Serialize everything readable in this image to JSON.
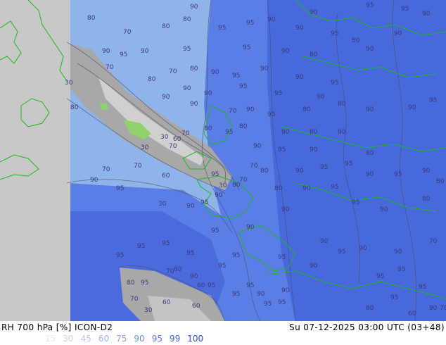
{
  "header": {
    "title_left": "RH 700 hPa [%] ICON-D2",
    "title_right": "Su 07-12-2025 03:00 UTC (03+48)"
  },
  "legend": {
    "items": [
      {
        "label": "15",
        "color": "#e6e6f5"
      },
      {
        "label": "30",
        "color": "#d0d0ee"
      },
      {
        "label": "45",
        "color": "#b8c4ea"
      },
      {
        "label": "60",
        "color": "#9fb6ea"
      },
      {
        "label": "75",
        "color": "#86a6ea"
      },
      {
        "label": "90",
        "color": "#6e90e6"
      },
      {
        "label": "95",
        "color": "#5a78e0"
      },
      {
        "label": "99",
        "color": "#4662d6"
      },
      {
        "label": "100",
        "color": "#3048c8"
      }
    ]
  },
  "colors": {
    "land": "#c8c8c8",
    "no_data": "#c8c8c8",
    "dry": "#a8a8a8",
    "very_dry": "#8fd16b",
    "moist": "#8fb4ea",
    "humid": "#5b7ee6",
    "saturated": "#4464d8",
    "coastline": "#1db81d",
    "contour": "#4a4a6a"
  },
  "contour_labels": [
    {
      "t": "80"
    },
    {
      "t": "90"
    },
    {
      "t": "95"
    },
    {
      "t": "90"
    },
    {
      "t": "90"
    },
    {
      "t": "95"
    },
    {
      "t": "95"
    },
    {
      "t": "90"
    },
    {
      "t": "70"
    },
    {
      "t": "80"
    },
    {
      "t": "80"
    },
    {
      "t": "95"
    },
    {
      "t": "90"
    },
    {
      "t": "95"
    },
    {
      "t": "80"
    },
    {
      "t": "90"
    },
    {
      "t": "90"
    },
    {
      "t": "95"
    },
    {
      "t": "90"
    },
    {
      "t": "95"
    },
    {
      "t": "95"
    },
    {
      "t": "90"
    },
    {
      "t": "80"
    },
    {
      "t": "90"
    },
    {
      "t": "70"
    },
    {
      "t": "70"
    },
    {
      "t": "80"
    },
    {
      "t": "90"
    },
    {
      "t": "95"
    },
    {
      "t": "90"
    },
    {
      "t": "90"
    },
    {
      "t": "95"
    },
    {
      "t": "30"
    },
    {
      "t": "80"
    },
    {
      "t": "90"
    },
    {
      "t": "90"
    },
    {
      "t": "90"
    },
    {
      "t": "95"
    },
    {
      "t": "95"
    },
    {
      "t": "90"
    },
    {
      "t": "80"
    },
    {
      "t": "90"
    },
    {
      "t": "70"
    },
    {
      "t": "90"
    },
    {
      "t": "95"
    },
    {
      "t": "80"
    },
    {
      "t": "80"
    },
    {
      "t": "90"
    },
    {
      "t": "90"
    },
    {
      "t": "95"
    },
    {
      "t": "70"
    },
    {
      "t": "80"
    },
    {
      "t": "95"
    },
    {
      "t": "90"
    },
    {
      "t": "80"
    },
    {
      "t": "90"
    },
    {
      "t": "30"
    },
    {
      "t": "60"
    },
    {
      "t": "70"
    },
    {
      "t": "80"
    },
    {
      "t": "90"
    },
    {
      "t": "95"
    },
    {
      "t": "90"
    },
    {
      "t": "80"
    },
    {
      "t": "30"
    },
    {
      "t": "90"
    },
    {
      "t": "95"
    },
    {
      "t": "95"
    },
    {
      "t": "90"
    },
    {
      "t": "95"
    },
    {
      "t": "90"
    },
    {
      "t": "80"
    },
    {
      "t": "70"
    },
    {
      "t": "70"
    },
    {
      "t": "60"
    },
    {
      "t": "70"
    },
    {
      "t": "80"
    },
    {
      "t": "90"
    },
    {
      "t": "95"
    },
    {
      "t": "80"
    },
    {
      "t": "90"
    },
    {
      "t": "90"
    },
    {
      "t": "95"
    },
    {
      "t": "70"
    },
    {
      "t": "30"
    },
    {
      "t": "80"
    },
    {
      "t": "90"
    },
    {
      "t": "95"
    },
    {
      "t": "95"
    },
    {
      "t": "90"
    },
    {
      "t": "95"
    },
    {
      "t": "90"
    },
    {
      "t": "95"
    },
    {
      "t": "90"
    },
    {
      "t": "80"
    },
    {
      "t": "70"
    },
    {
      "t": "95"
    },
    {
      "t": "95"
    },
    {
      "t": "95"
    },
    {
      "t": "95"
    },
    {
      "t": "90"
    },
    {
      "t": "95"
    },
    {
      "t": "90"
    },
    {
      "t": "90"
    },
    {
      "t": "70"
    },
    {
      "t": "80"
    },
    {
      "t": "90"
    },
    {
      "t": "60"
    },
    {
      "t": "95"
    },
    {
      "t": "95"
    },
    {
      "t": "95"
    },
    {
      "t": "90"
    },
    {
      "t": "80"
    },
    {
      "t": "95"
    },
    {
      "t": "95"
    },
    {
      "t": "95"
    },
    {
      "t": "60"
    },
    {
      "t": "95"
    },
    {
      "t": "90"
    },
    {
      "t": "90"
    },
    {
      "t": "95"
    },
    {
      "t": "30"
    },
    {
      "t": "60"
    },
    {
      "t": "95"
    },
    {
      "t": "30"
    },
    {
      "t": "80"
    },
    {
      "t": "95"
    },
    {
      "t": "95"
    },
    {
      "t": "95"
    },
    {
      "t": "95"
    },
    {
      "t": "90"
    },
    {
      "t": "70"
    },
    {
      "t": "60"
    },
    {
      "t": "70"
    }
  ]
}
